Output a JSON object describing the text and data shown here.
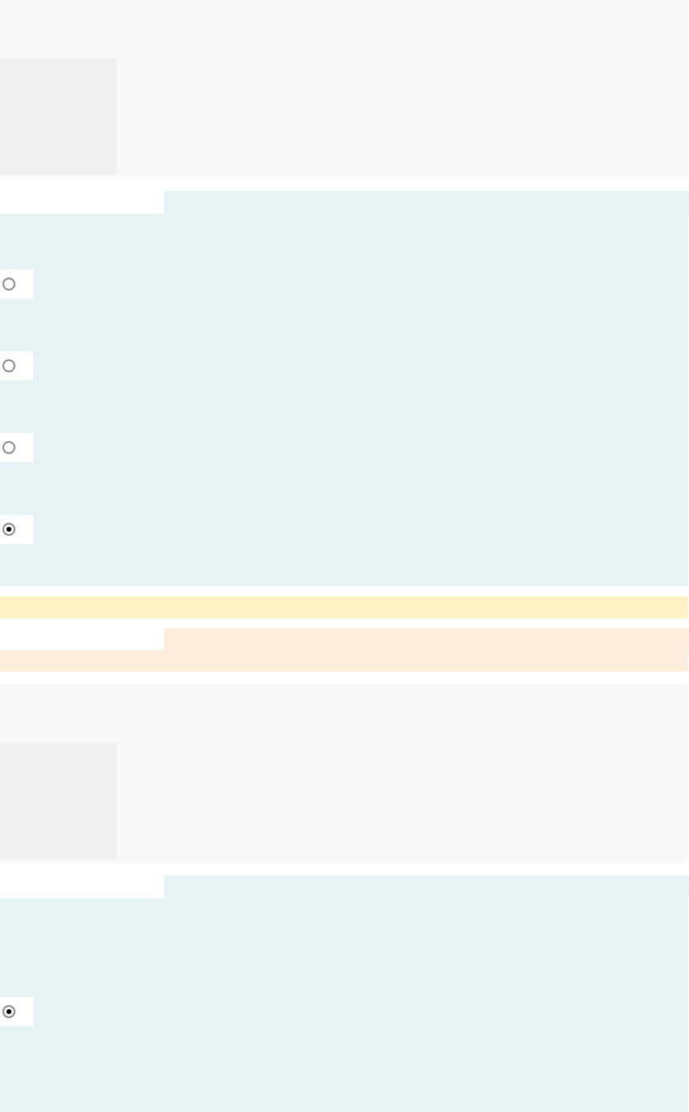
{
  "questions": [
    {
      "options": [
        {
          "selected": false
        },
        {
          "selected": false
        },
        {
          "selected": false
        },
        {
          "selected": true
        }
      ]
    },
    {
      "options": [
        {
          "selected": true
        }
      ]
    }
  ]
}
